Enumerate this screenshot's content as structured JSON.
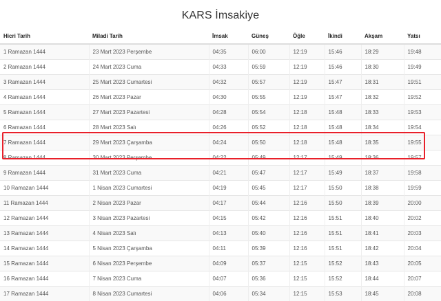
{
  "title": "KARS İmsakiye",
  "table": {
    "headers": [
      "Hicri Tarih",
      "Miladi Tarih",
      "İmsak",
      "Güneş",
      "Öğle",
      "İkindi",
      "Akşam",
      "Yatsı"
    ],
    "rows": [
      [
        "1 Ramazan 1444",
        "23 Mart 2023 Perşembe",
        "04:35",
        "06:00",
        "12:19",
        "15:46",
        "18:29",
        "19:48"
      ],
      [
        "2 Ramazan 1444",
        "24 Mart 2023 Cuma",
        "04:33",
        "05:59",
        "12:19",
        "15:46",
        "18:30",
        "19:49"
      ],
      [
        "3 Ramazan 1444",
        "25 Mart 2023 Cumartesi",
        "04:32",
        "05:57",
        "12:19",
        "15:47",
        "18:31",
        "19:51"
      ],
      [
        "4 Ramazan 1444",
        "26 Mart 2023 Pazar",
        "04:30",
        "05:55",
        "12:19",
        "15:47",
        "18:32",
        "19:52"
      ],
      [
        "5 Ramazan 1444",
        "27 Mart 2023 Pazartesi",
        "04:28",
        "05:54",
        "12:18",
        "15:48",
        "18:33",
        "19:53"
      ],
      [
        "6 Ramazan 1444",
        "28 Mart 2023 Salı",
        "04:26",
        "05:52",
        "12:18",
        "15:48",
        "18:34",
        "19:54"
      ],
      [
        "7 Ramazan 1444",
        "29 Mart 2023 Çarşamba",
        "04:24",
        "05:50",
        "12:18",
        "15:48",
        "18:35",
        "19:55"
      ],
      [
        "8 Ramazan 1444",
        "30 Mart 2023 Perşembe",
        "04:22",
        "05:49",
        "12:17",
        "15:49",
        "18:36",
        "19:57"
      ],
      [
        "9 Ramazan 1444",
        "31 Mart 2023 Cuma",
        "04:21",
        "05:47",
        "12:17",
        "15:49",
        "18:37",
        "19:58"
      ],
      [
        "10 Ramazan 1444",
        "1 Nisan 2023 Cumartesi",
        "04:19",
        "05:45",
        "12:17",
        "15:50",
        "18:38",
        "19:59"
      ],
      [
        "11 Ramazan 1444",
        "2 Nisan 2023 Pazar",
        "04:17",
        "05:44",
        "12:16",
        "15:50",
        "18:39",
        "20:00"
      ],
      [
        "12 Ramazan 1444",
        "3 Nisan 2023 Pazartesi",
        "04:15",
        "05:42",
        "12:16",
        "15:51",
        "18:40",
        "20:02"
      ],
      [
        "13 Ramazan 1444",
        "4 Nisan 2023 Salı",
        "04:13",
        "05:40",
        "12:16",
        "15:51",
        "18:41",
        "20:03"
      ],
      [
        "14 Ramazan 1444",
        "5 Nisan 2023 Çarşamba",
        "04:11",
        "05:39",
        "12:16",
        "15:51",
        "18:42",
        "20:04"
      ],
      [
        "15 Ramazan 1444",
        "6 Nisan 2023 Perşembe",
        "04:09",
        "05:37",
        "12:15",
        "15:52",
        "18:43",
        "20:05"
      ],
      [
        "16 Ramazan 1444",
        "7 Nisan 2023 Cuma",
        "04:07",
        "05:36",
        "12:15",
        "15:52",
        "18:44",
        "20:07"
      ],
      [
        "17 Ramazan 1444",
        "8 Nisan 2023 Cumartesi",
        "04:06",
        "05:34",
        "12:15",
        "15:53",
        "18:45",
        "20:08"
      ]
    ]
  },
  "highlight": {
    "rows": [
      "7 Ramazan 1444",
      "8 Ramazan 1444"
    ],
    "color": "#e8202a"
  }
}
